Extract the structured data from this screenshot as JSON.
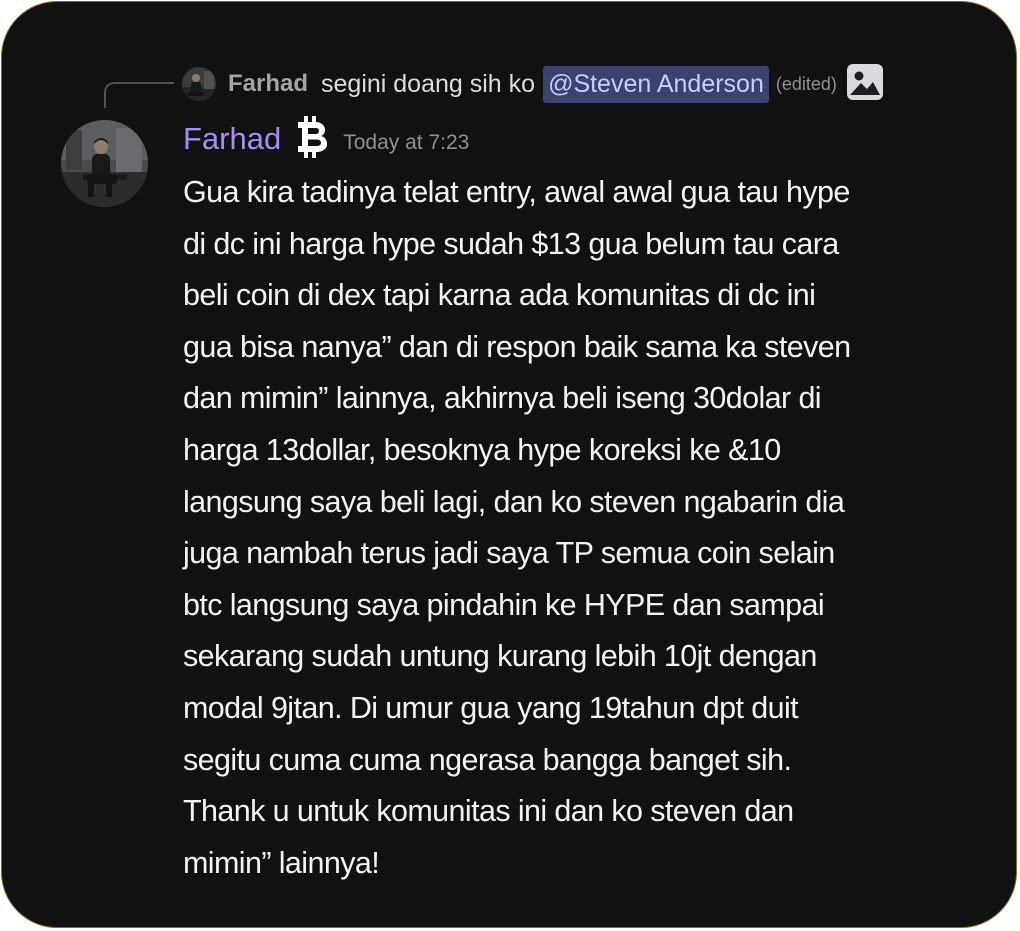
{
  "reply": {
    "author": "Farhad",
    "text": "segini doang sih ko",
    "mention": "@Steven Anderson",
    "edited": "(edited)",
    "attachment_icon": "image-icon"
  },
  "message": {
    "author": "Farhad",
    "badge_icon": "bitcoin-icon",
    "timestamp": "Today at 7:23",
    "body": "Gua kira tadinya telat entry, awal awal gua tau hype\ndi dc ini harga hype sudah $13 gua belum tau cara\nbeli coin di dex tapi karna ada komunitas di dc ini\ngua bisa nanya” dan di respon baik sama ka steven\ndan mimin” lainnya, akhirnya beli iseng 30dolar di\nharga 13dollar, besoknya hype koreksi ke &10\nlangsung saya beli lagi, dan ko steven ngabarin dia\njuga nambah terus jadi saya TP semua coin selain\nbtc langsung saya pindahin ke HYPE dan sampai\nsekarang sudah untung kurang lebih 10jt dengan\nmodal 9jtan. Di umur gua yang 19tahun dpt duit\nsegitu cuma cuma ngerasa bangga banget sih.\nThank u untuk komunitas ini dan ko steven dan\nmimin” lainnya!"
  },
  "colors": {
    "background": "#111112",
    "border": "#8a6a1e",
    "author": "#a78bfa",
    "mention_bg": "#3c4270",
    "mention_text": "#c9cdfb",
    "body_text": "#f2f3f5",
    "muted": "#8e9097"
  }
}
